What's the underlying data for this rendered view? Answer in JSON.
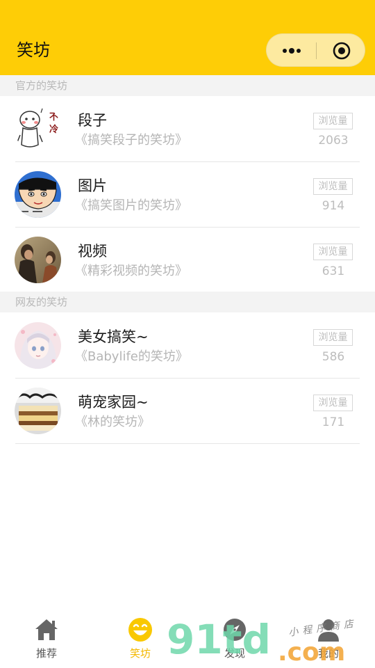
{
  "header": {
    "title": "笑坊",
    "capsule": {
      "menu_icon": "more-dots-icon",
      "close_icon": "target-circle-icon"
    }
  },
  "sections": [
    {
      "title": "官方的笑坊",
      "items": [
        {
          "title": "段子",
          "subtitle": "《搞笑段子的笑坊》",
          "views_label": "浏览量",
          "views": "2063",
          "avatar": "cartoon-avatar",
          "avatar_text": "不冷"
        },
        {
          "title": "图片",
          "subtitle": "《搞笑图片的笑坊》",
          "views_label": "浏览量",
          "views": "914",
          "avatar": "crayon-shin-chan-avatar"
        },
        {
          "title": "视频",
          "subtitle": "《精彩视频的笑坊》",
          "views_label": "浏览量",
          "views": "631",
          "avatar": "movie-still-avatar"
        }
      ]
    },
    {
      "title": "网友的笑坊",
      "items": [
        {
          "title": "美女搞笑~",
          "subtitle": "《Babylife的笑坊》",
          "views_label": "浏览量",
          "views": "586",
          "avatar": "anime-girl-avatar"
        },
        {
          "title": "萌宠家园~",
          "subtitle": "《林的笑坊》",
          "views_label": "浏览量",
          "views": "171",
          "avatar": "cake-photo-avatar"
        }
      ]
    }
  ],
  "tabbar": {
    "items": [
      {
        "label": "推荐",
        "icon": "home-icon",
        "active": false
      },
      {
        "label": "笑坊",
        "icon": "laughing-face-icon",
        "active": true
      },
      {
        "label": "发现",
        "icon": "compass-icon",
        "active": false
      },
      {
        "label": "我的",
        "icon": "user-icon",
        "active": false
      }
    ]
  },
  "watermark": {
    "number": "91td",
    "dot_com": ".com",
    "handwriting": "小程序商店"
  },
  "colors": {
    "header_bg": "#fecd06",
    "accent": "#f3b800",
    "section_bg": "#f3f3f3",
    "muted_text": "#b5b5b5"
  }
}
